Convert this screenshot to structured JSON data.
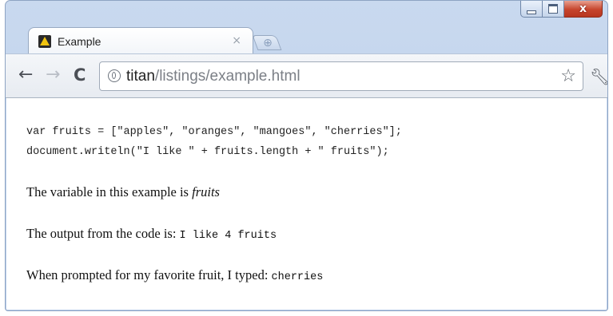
{
  "window": {
    "close_label": "x"
  },
  "tab": {
    "title": "Example",
    "close_glyph": "×",
    "favicon": "letter-A-logo-icon"
  },
  "toolbar": {
    "back_glyph": "←",
    "forward_glyph": "→",
    "reload_glyph": "C",
    "url_host": "titan",
    "url_path": "/listings/example.html",
    "star_glyph": "☆",
    "wrench_glyph": "🔧"
  },
  "content": {
    "code_line1": "var fruits = [\"apples\", \"oranges\", \"mangoes\", \"cherries\"];",
    "code_line2": "document.writeln(\"I like \" + fruits.length + \" fruits\");",
    "p1_text": "The variable in this example is ",
    "p1_var": "fruits",
    "p2_text": "The output from the code is: ",
    "p2_output": "I like 4 fruits",
    "p3_text": "When prompted for my favorite fruit, I typed: ",
    "p3_value": "cherries"
  },
  "colors": {
    "frame": "#c9d9ef",
    "close_button": "#c6452d"
  }
}
